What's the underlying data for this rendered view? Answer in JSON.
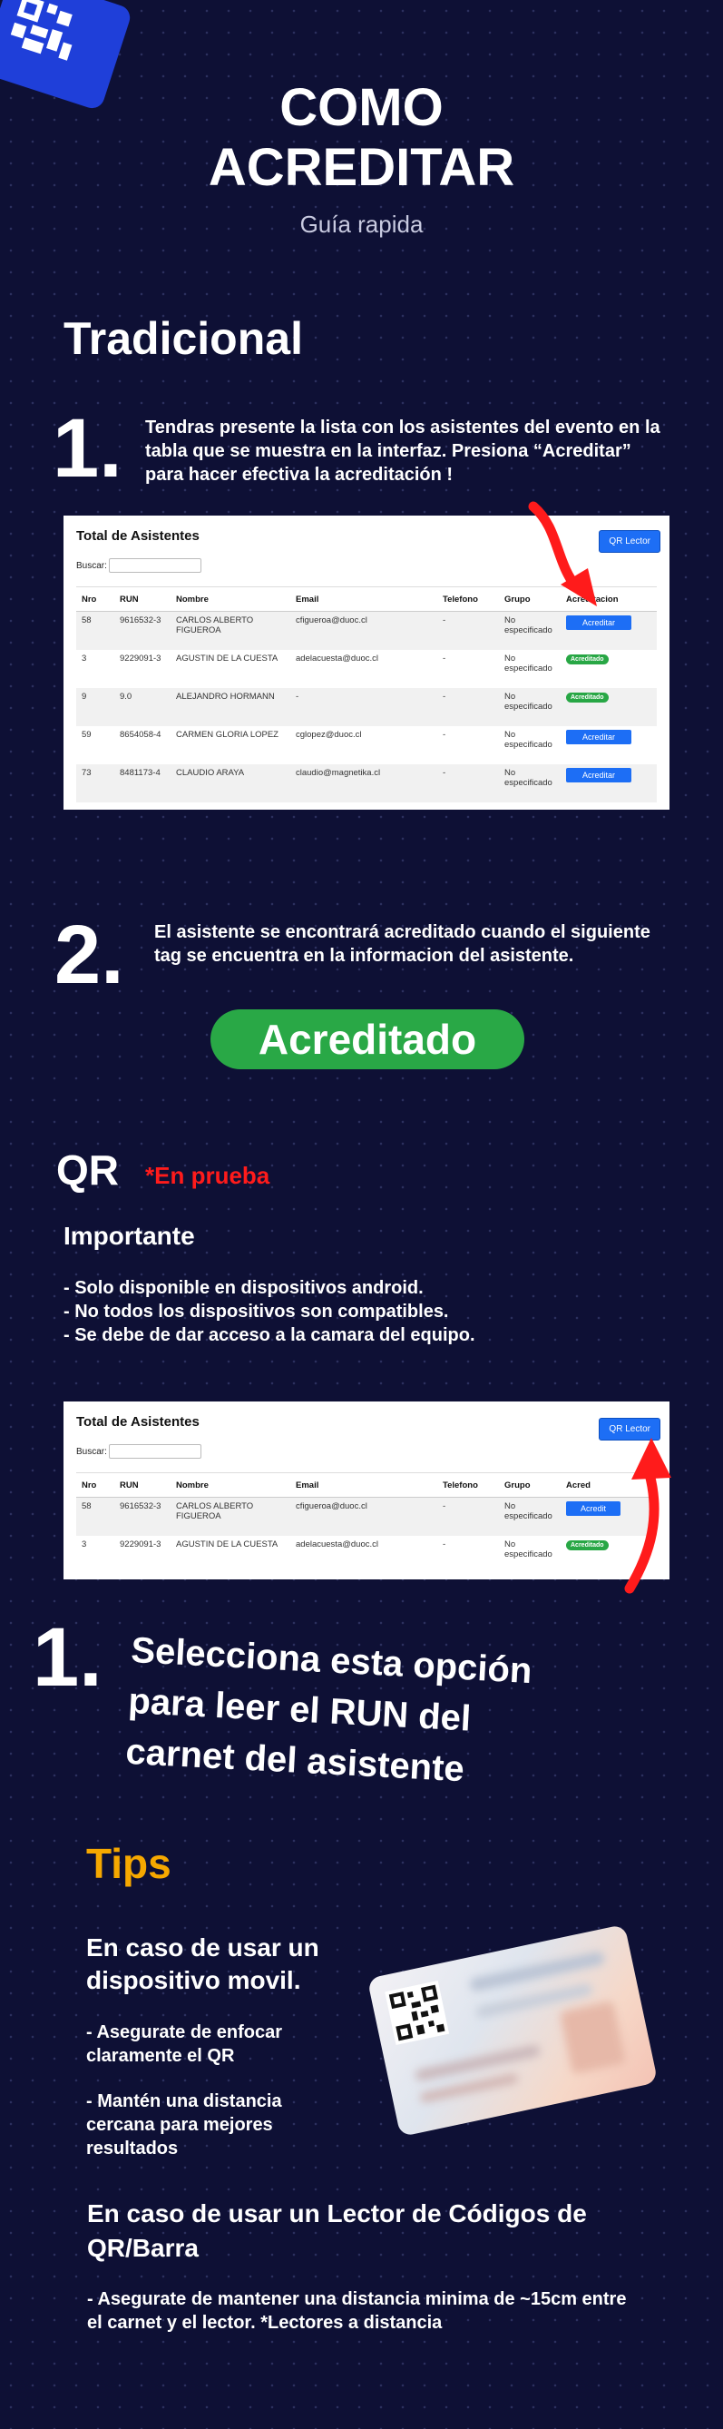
{
  "header": {
    "title_line1": "COMO",
    "title_line2": "ACREDITAR",
    "subtitle": "Guía rapida"
  },
  "tradicional": {
    "heading": "Tradicional",
    "step1": {
      "number": "1.",
      "text_line1": "Tendras presente la lista con los asistentes del evento en la",
      "text_line2": "tabla que se muestra  en la interfaz. Presiona “Acreditar”",
      "text_line3": "para hacer efectiva la acreditación !"
    },
    "step2": {
      "number": "2.",
      "text_line1": "El asistente se encontrará acreditado cuando el siguiente",
      "text_line2": "tag se encuentra en la informacion del asistente.",
      "badge": "Acreditado"
    }
  },
  "table1": {
    "title": "Total de Asistentes",
    "qr_button": "QR Lector",
    "search_label": "Buscar:",
    "columns": [
      "Nro",
      "RUN",
      "Nombre",
      "Email",
      "Telefono",
      "Grupo",
      "Acreditacion"
    ],
    "rows": [
      {
        "nro": "58",
        "run": "9616532-3",
        "nombre1": "CARLOS ALBERTO",
        "nombre2": "FIGUEROA",
        "email": "cfigueroa@duoc.cl",
        "telefono": "-",
        "grupo1": "No",
        "grupo2": "especificado",
        "action": "Acreditar"
      },
      {
        "nro": "3",
        "run": "9229091-3",
        "nombre1": "AGUSTIN DE LA CUESTA",
        "nombre2": "",
        "email": "adelacuesta@duoc.cl",
        "telefono": "-",
        "grupo1": "No",
        "grupo2": "especificado",
        "action": "Acreditado"
      },
      {
        "nro": "9",
        "run": "9.0",
        "nombre1": "ALEJANDRO HORMANN",
        "nombre2": "",
        "email": "-",
        "telefono": "-",
        "grupo1": "No",
        "grupo2": "especificado",
        "action": "Acreditado"
      },
      {
        "nro": "59",
        "run": "8654058-4",
        "nombre1": "CARMEN GLORIA LOPEZ",
        "nombre2": "",
        "email": "cglopez@duoc.cl",
        "telefono": "-",
        "grupo1": "No",
        "grupo2": "especificado",
        "action": "Acreditar"
      },
      {
        "nro": "73",
        "run": "8481173-4",
        "nombre1": "CLAUDIO ARAYA",
        "nombre2": "",
        "email": "claudio@magnetika.cl",
        "telefono": "-",
        "grupo1": "No",
        "grupo2": "especificado",
        "action": "Acreditar"
      }
    ]
  },
  "qr_section": {
    "heading": "QR",
    "tag": "*En prueba",
    "important_heading": "Importante",
    "items": [
      "- Solo disponible en dispositivos android.",
      "- No todos los dispositivos son compatibles.",
      "- Se debe de dar acceso a la camara del equipo."
    ]
  },
  "table2": {
    "title": "Total de Asistentes",
    "qr_button": "QR Lector",
    "search_label": "Buscar:",
    "columns": [
      "Nro",
      "RUN",
      "Nombre",
      "Email",
      "Telefono",
      "Grupo",
      "Acred"
    ],
    "rows": [
      {
        "nro": "58",
        "run": "9616532-3",
        "nombre1": "CARLOS ALBERTO",
        "nombre2": "FIGUEROA",
        "email": "cfigueroa@duoc.cl",
        "telefono": "-",
        "grupo1": "No",
        "grupo2": "especificado",
        "action": "Acredit"
      },
      {
        "nro": "3",
        "run": "9229091-3",
        "nombre1": "AGUSTIN DE LA CUESTA",
        "nombre2": "",
        "email": "adelacuesta@duoc.cl",
        "telefono": "-",
        "grupo1": "No",
        "grupo2": "especificado",
        "action": "Acreditado"
      }
    ]
  },
  "qr_step1": {
    "number": "1.",
    "line1": "Selecciona esta opción",
    "line2": "para leer el RUN del",
    "line3": "carnet del asistente"
  },
  "tips": {
    "heading": "Tips",
    "mobile_heading_line1": "En caso de usar un",
    "mobile_heading_line2": "dispositivo movil.",
    "mobile_tip1_line1": "- Asegurate de enfocar",
    "mobile_tip1_line2": "claramente el QR",
    "mobile_tip2_line1": "- Mantén una distancia",
    "mobile_tip2_line2": "cercana para mejores",
    "mobile_tip2_line3": "resultados",
    "reader_heading_line1": "En caso de usar un Lector de Códigos de",
    "reader_heading_line2": "QR/Barra",
    "reader_tip_line1": "- Asegurate de mantener una distancia minima de ~15cm entre",
    "reader_tip_line2": "el carnet y el lector. *Lectores a distancia"
  },
  "colors": {
    "background": "#0e1035",
    "accent_red": "#ff1b1b",
    "tips_orange": "#f6a800",
    "badge_green": "#29a846",
    "button_blue": "#1d6ef5"
  }
}
